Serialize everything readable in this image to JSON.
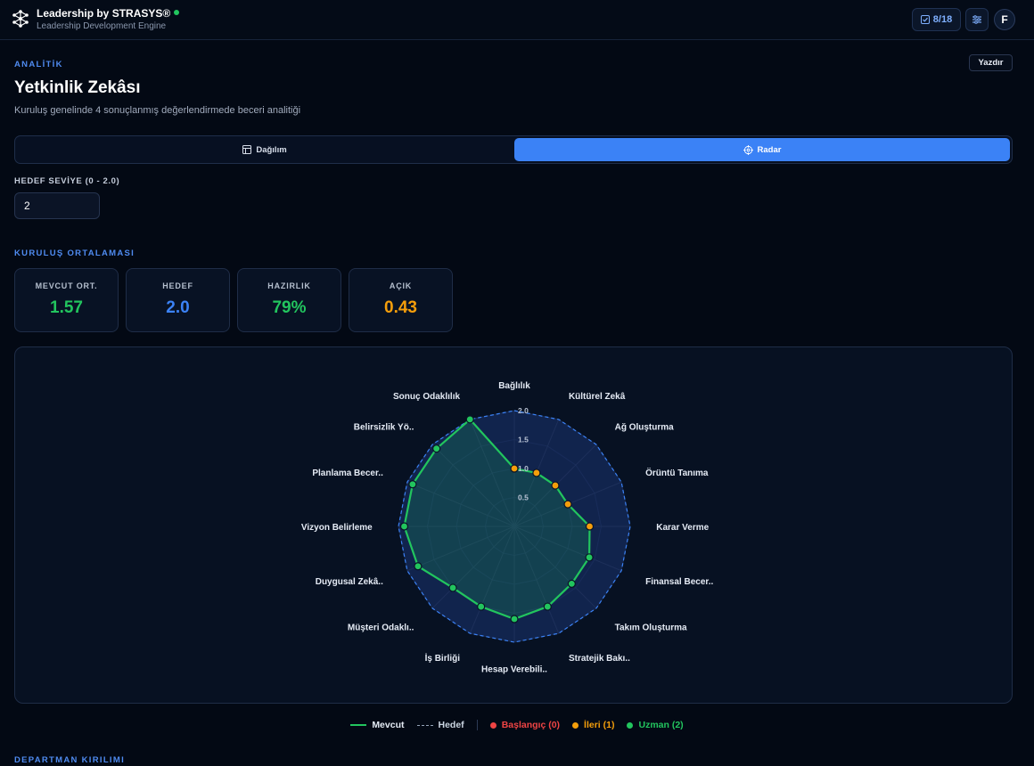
{
  "header": {
    "app_title": "Leadership by STRASYS®",
    "app_subtitle": "Leadership Development Engine",
    "progress": "8/18",
    "avatar_initial": "F"
  },
  "page": {
    "section": "ANALİTİK",
    "title": "Yetkinlik Zekâsı",
    "subtitle": "Kuruluş genelinde 4 sonuçlanmış değerlendirmede beceri analitiği",
    "print_label": "Yazdır"
  },
  "tabs": [
    {
      "label": "Dağılım",
      "active": false
    },
    {
      "label": "Radar",
      "active": true
    }
  ],
  "target_field": {
    "label": "HEDEF SEVİYE (0 - 2.0)",
    "value": "2"
  },
  "org_average": {
    "section": "KURULUŞ ORTALAMASI",
    "stats": [
      {
        "label": "MEVCUT ORT.",
        "value": "1.57",
        "color": "#22c55e"
      },
      {
        "label": "HEDEF",
        "value": "2.0",
        "color": "#3b82f6"
      },
      {
        "label": "HAZIRLIK",
        "value": "79%",
        "color": "#22c55e"
      },
      {
        "label": "AÇIK",
        "value": "0.43",
        "color": "#f59e0b"
      }
    ]
  },
  "chart_data": {
    "type": "radar",
    "axes": [
      "Bağlılık",
      "Kültürel Zekâ",
      "Ağ Oluşturma",
      "Örüntü Tanıma",
      "Karar Verme",
      "Finansal Becer..",
      "Takım Oluşturma",
      "Stratejik Bakı..",
      "Hesap Verebili..",
      "İş Birliği",
      "Müşteri Odaklı..",
      "Duygusal Zekâ..",
      "Vizyon Belirleme",
      "Planlama Becer..",
      "Belirsizlik Yö..",
      "Sonuç Odaklılık"
    ],
    "rlim": [
      0,
      2.0
    ],
    "ticks": [
      "0.5",
      "1.0",
      "1.5",
      "2.0"
    ],
    "series": [
      {
        "name": "Mevcut",
        "values": [
          1.0,
          1.0,
          1.0,
          1.0,
          1.3,
          1.4,
          1.4,
          1.5,
          1.6,
          1.5,
          1.5,
          1.8,
          1.9,
          1.9,
          1.9,
          2.0
        ]
      },
      {
        "name": "Hedef",
        "values": [
          2.0,
          2.0,
          2.0,
          2.0,
          2.0,
          2.0,
          2.0,
          2.0,
          2.0,
          2.0,
          2.0,
          2.0,
          2.0,
          2.0,
          2.0,
          2.0
        ]
      }
    ],
    "levels": [
      "ileri",
      "ileri",
      "ileri",
      "ileri",
      "ileri",
      "uzman",
      "uzman",
      "uzman",
      "uzman",
      "uzman",
      "uzman",
      "uzman",
      "uzman",
      "uzman",
      "uzman",
      "uzman"
    ]
  },
  "legend": {
    "current": "Mevcut",
    "target": "Hedef",
    "beginner": "Başlangıç (0)",
    "advanced": "İleri (1)",
    "expert": "Uzman (2)",
    "colors": {
      "current": "#22c55e",
      "target": "#94a3b8",
      "beginner": "#ef4444",
      "advanced": "#f59e0b",
      "expert": "#22c55e"
    }
  },
  "department": {
    "section": "DEPARTMAN KIRILIMI"
  }
}
